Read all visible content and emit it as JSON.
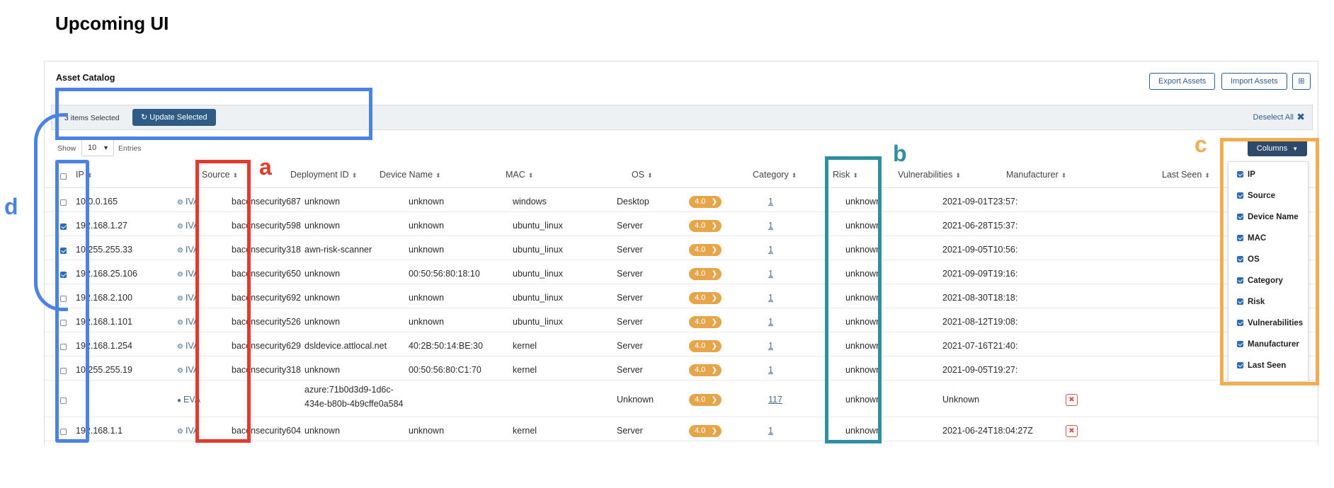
{
  "heading": "Upcoming UI",
  "panel": {
    "title": "Asset Catalog",
    "export_label": "Export Assets",
    "import_label": "Import Assets",
    "grid_icon": "table-grid-icon"
  },
  "selection_bar": {
    "count_text": "3 items Selected",
    "update_label": "Update Selected",
    "deselect_label": "Deselect All",
    "deselect_icon": "✖"
  },
  "pagination": {
    "show_label": "Show",
    "page_size": "10",
    "entries_label": "Entries"
  },
  "headers": {
    "ip": "IP",
    "source": "Source",
    "deployment_id": "Deployment ID",
    "device_name": "Device Name",
    "mac": "MAC",
    "os": "OS",
    "category": "Category",
    "risk": "Risk",
    "vulnerabilities": "Vulnerabilities",
    "manufacturer": "Manufacturer",
    "last_seen": "Last Seen"
  },
  "rows": [
    {
      "checked": false,
      "ip": "10.0.0.165",
      "source": "IVA",
      "deployment_id": "baconsecurity687",
      "device_name": "unknown",
      "mac": "unknown",
      "os": "windows",
      "category": "Desktop",
      "risk": "4.0",
      "vulnerabilities": "1",
      "manufacturer": "unknown",
      "last_seen": "2021-09-01T23:57:",
      "deletable": false
    },
    {
      "checked": true,
      "ip": "192.168.1.27",
      "source": "IVA",
      "deployment_id": "baconsecurity598",
      "device_name": "unknown",
      "mac": "unknown",
      "os": "ubuntu_linux",
      "category": "Server",
      "risk": "4.0",
      "vulnerabilities": "1",
      "manufacturer": "unknown",
      "last_seen": "2021-06-28T15:37:",
      "deletable": false
    },
    {
      "checked": true,
      "ip": "10.255.255.33",
      "source": "IVA",
      "deployment_id": "baconsecurity318",
      "device_name": "awn-risk-scanner",
      "mac": "unknown",
      "os": "ubuntu_linux",
      "category": "Server",
      "risk": "4.0",
      "vulnerabilities": "1",
      "manufacturer": "unknown",
      "last_seen": "2021-09-05T10:56:",
      "deletable": false
    },
    {
      "checked": true,
      "ip": "192.168.25.106",
      "source": "IVA",
      "deployment_id": "baconsecurity650",
      "device_name": "unknown",
      "mac": "00:50:56:80:18:10",
      "os": "ubuntu_linux",
      "category": "Server",
      "risk": "4.0",
      "vulnerabilities": "1",
      "manufacturer": "unknown",
      "last_seen": "2021-09-09T19:16:",
      "deletable": false
    },
    {
      "checked": false,
      "ip": "192.168.2.100",
      "source": "IVA",
      "deployment_id": "baconsecurity692",
      "device_name": "unknown",
      "mac": "unknown",
      "os": "ubuntu_linux",
      "category": "Server",
      "risk": "4.0",
      "vulnerabilities": "1",
      "manufacturer": "unknown",
      "last_seen": "2021-08-30T18:18:",
      "deletable": false
    },
    {
      "checked": false,
      "ip": "192.168.1.101",
      "source": "IVA",
      "deployment_id": "baconsecurity526",
      "device_name": "unknown",
      "mac": "unknown",
      "os": "ubuntu_linux",
      "category": "Server",
      "risk": "4.0",
      "vulnerabilities": "1",
      "manufacturer": "unknown",
      "last_seen": "2021-08-12T19:08:",
      "deletable": false
    },
    {
      "checked": false,
      "ip": "192.168.1.254",
      "source": "IVA",
      "deployment_id": "baconsecurity629",
      "device_name": "dsldevice.attlocal.net",
      "mac": "40:2B:50:14:BE:30",
      "os": "kernel",
      "category": "Server",
      "risk": "4.0",
      "vulnerabilities": "1",
      "manufacturer": "unknown",
      "last_seen": "2021-07-16T21:40:",
      "deletable": false
    },
    {
      "checked": false,
      "ip": "10.255.255.19",
      "source": "IVA",
      "deployment_id": "baconsecurity318",
      "device_name": "unknown",
      "mac": "00:50:56:80:C1:70",
      "os": "kernel",
      "category": "Server",
      "risk": "4.0",
      "vulnerabilities": "1",
      "manufacturer": "unknown",
      "last_seen": "2021-09-05T19:27:",
      "deletable": false
    },
    {
      "checked": false,
      "ip": "",
      "source": "EVA",
      "deployment_id": "",
      "device_name_line1": "azure:71b0d3d9-1d6c-",
      "device_name_line2": "434e-b80b-4b9cffe0a584",
      "mac": "",
      "os": "",
      "category": "Unknown",
      "risk": "4.0",
      "vulnerabilities": "117",
      "manufacturer": "unknown",
      "last_seen": "Unknown",
      "deletable": true
    },
    {
      "checked": false,
      "ip": "192.168.1.1",
      "source": "IVA",
      "deployment_id": "baconsecurity604",
      "device_name": "unknown",
      "mac": "unknown",
      "os": "kernel",
      "category": "Server",
      "risk": "4.0",
      "vulnerabilities": "1",
      "manufacturer": "unknown",
      "last_seen": "2021-06-24T18:04:27Z",
      "deletable": true
    }
  ],
  "columns_menu": {
    "button_label": "Columns",
    "items": [
      "IP",
      "Source",
      "Device Name",
      "MAC",
      "OS",
      "Category",
      "Risk",
      "Vulnerabilities",
      "Manufacturer",
      "Last Seen"
    ]
  },
  "annotations": {
    "a": "a",
    "b": "b",
    "c": "c",
    "d": "d",
    "colors": {
      "a": "#e33a2e",
      "b": "#2f8ea1",
      "c": "#f0ad52",
      "d": "#4a82e6"
    }
  },
  "icons": {
    "sort": "⬍",
    "chevron_down": "▼",
    "chevron_right": "❯",
    "iva": "⚙",
    "eva": "●",
    "trash": "✖",
    "grid": "⊞",
    "refresh": "↻"
  },
  "colors": {
    "primary": "#2e5c85",
    "risk_badge": "#e7a54a",
    "delete": "#d9534f"
  }
}
